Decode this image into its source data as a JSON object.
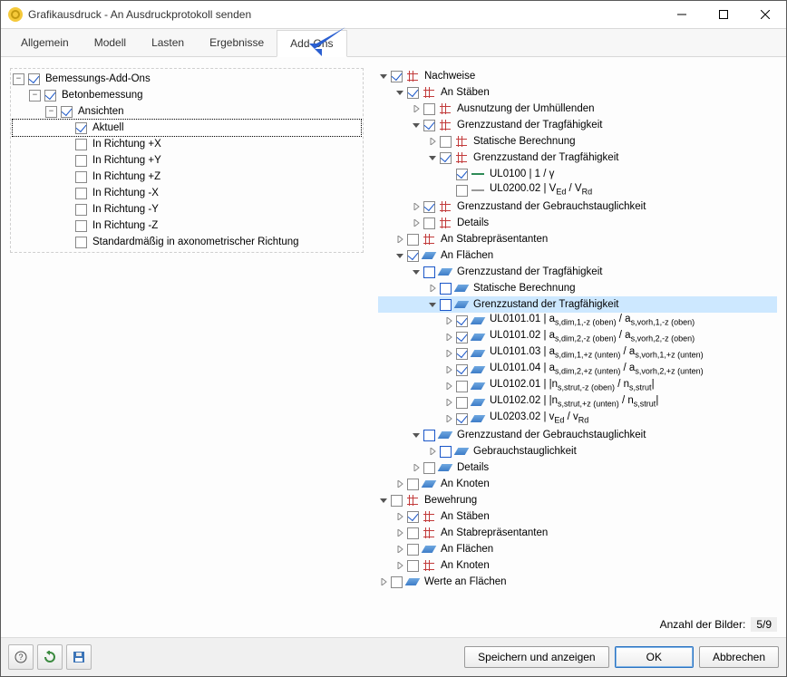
{
  "window": {
    "title": "Grafikausdruck - An Ausdruckprotokoll senden"
  },
  "tabs": [
    {
      "label": "Allgemein"
    },
    {
      "label": "Modell"
    },
    {
      "label": "Lasten"
    },
    {
      "label": "Ergebnisse"
    },
    {
      "label": "Add-Ons",
      "active": true
    }
  ],
  "left": [
    {
      "d": 0,
      "type": "box",
      "open": true,
      "chk": "on",
      "label": "Bemessungs-Add-Ons"
    },
    {
      "d": 1,
      "type": "box",
      "open": true,
      "chk": "on",
      "label": "Betonbemessung"
    },
    {
      "d": 2,
      "type": "box",
      "open": true,
      "chk": "on",
      "label": "Ansichten"
    },
    {
      "d": 3,
      "type": "leaf",
      "chk": "on",
      "label": "Aktuell",
      "sel": "focus"
    },
    {
      "d": 3,
      "type": "leaf",
      "chk": "off",
      "label": "In Richtung +X"
    },
    {
      "d": 3,
      "type": "leaf",
      "chk": "off",
      "label": "In Richtung +Y"
    },
    {
      "d": 3,
      "type": "leaf",
      "chk": "off",
      "label": "In Richtung +Z"
    },
    {
      "d": 3,
      "type": "leaf",
      "chk": "off",
      "label": "In Richtung -X"
    },
    {
      "d": 3,
      "type": "leaf",
      "chk": "off",
      "label": "In Richtung -Y"
    },
    {
      "d": 3,
      "type": "leaf",
      "chk": "off",
      "label": "In Richtung -Z"
    },
    {
      "d": 3,
      "type": "leaf",
      "chk": "off",
      "label": "Standardmäßig in axonometrischer Richtung"
    }
  ],
  "right": [
    {
      "d": 0,
      "chev": "down",
      "chk": "on",
      "icon": "chart",
      "label": "Nachweise"
    },
    {
      "d": 1,
      "chev": "down",
      "chk": "on",
      "icon": "chart",
      "label": "An Stäben"
    },
    {
      "d": 2,
      "chev": "right",
      "chk": "off",
      "icon": "chart",
      "label": "Ausnutzung der Umhüllenden"
    },
    {
      "d": 2,
      "chev": "down",
      "chk": "on",
      "icon": "chart",
      "label": "Grenzzustand der Tragfähigkeit"
    },
    {
      "d": 3,
      "chev": "right",
      "chk": "off",
      "icon": "chart",
      "label": "Statische Berechnung"
    },
    {
      "d": 3,
      "chev": "down",
      "chk": "on",
      "icon": "chart",
      "label": "Grenzzustand der Tragfähigkeit"
    },
    {
      "d": 4,
      "chev": "none",
      "chk": "on",
      "icon": "gline",
      "label": "UL0100 | 1 / γ"
    },
    {
      "d": 4,
      "chev": "none",
      "chk": "off",
      "icon": "gray",
      "html": "UL0200.02 | V<sub>Ed</sub> / V<sub>Rd</sub>"
    },
    {
      "d": 2,
      "chev": "right",
      "chk": "on",
      "icon": "chart",
      "label": "Grenzzustand der Gebrauchstauglichkeit"
    },
    {
      "d": 2,
      "chev": "right",
      "chk": "off",
      "icon": "chart",
      "label": "Details"
    },
    {
      "d": 1,
      "chev": "right",
      "chk": "off",
      "icon": "chart",
      "label": "An Stabrepräsentanten"
    },
    {
      "d": 1,
      "chev": "down",
      "chk": "on",
      "icon": "surf",
      "label": "An Flächen"
    },
    {
      "d": 2,
      "chev": "down",
      "chk": "outline",
      "icon": "surf",
      "label": "Grenzzustand der Tragfähigkeit"
    },
    {
      "d": 3,
      "chev": "right",
      "chk": "outline",
      "icon": "surf",
      "label": "Statische Berechnung"
    },
    {
      "d": 3,
      "chev": "down",
      "chk": "outline",
      "icon": "surf",
      "label": "Grenzzustand der Tragfähigkeit",
      "sel": "blue"
    },
    {
      "d": 4,
      "chev": "right",
      "chk": "on",
      "icon": "surf",
      "html": "UL0101.01 | a<sub>s,dim,1,-z (oben)</sub> / a<sub>s,vorh,1,-z (oben)</sub>"
    },
    {
      "d": 4,
      "chev": "right",
      "chk": "on",
      "icon": "surf",
      "html": "UL0101.02 | a<sub>s,dim,2,-z (oben)</sub> / a<sub>s,vorh,2,-z (oben)</sub>"
    },
    {
      "d": 4,
      "chev": "right",
      "chk": "on",
      "icon": "surf",
      "html": "UL0101.03 | a<sub>s,dim,1,+z (unten)</sub> / a<sub>s,vorh,1,+z (unten)</sub>"
    },
    {
      "d": 4,
      "chev": "right",
      "chk": "on",
      "icon": "surf",
      "html": "UL0101.04 | a<sub>s,dim,2,+z (unten)</sub> / a<sub>s,vorh,2,+z (unten)</sub>"
    },
    {
      "d": 4,
      "chev": "right",
      "chk": "off",
      "icon": "surf",
      "html": "UL0102.01 | |n<sub>s,strut,-z (oben)</sub> / n<sub>s,strut</sub>|"
    },
    {
      "d": 4,
      "chev": "right",
      "chk": "off",
      "icon": "surf",
      "html": "UL0102.02 | |n<sub>s,strut,+z (unten)</sub> / n<sub>s,strut</sub>|"
    },
    {
      "d": 4,
      "chev": "right",
      "chk": "on",
      "icon": "surf",
      "html": "UL0203.02 | v<sub>Ed</sub> / v<sub>Rd</sub>"
    },
    {
      "d": 2,
      "chev": "down",
      "chk": "outline",
      "icon": "surf",
      "label": "Grenzzustand der Gebrauchstauglichkeit"
    },
    {
      "d": 3,
      "chev": "right",
      "chk": "outline",
      "icon": "surf",
      "label": "Gebrauchstauglichkeit"
    },
    {
      "d": 2,
      "chev": "right",
      "chk": "off",
      "icon": "surf",
      "label": "Details"
    },
    {
      "d": 1,
      "chev": "right",
      "chk": "off",
      "icon": "surf",
      "label": "An Knoten"
    },
    {
      "d": 0,
      "chev": "down",
      "chk": "off",
      "icon": "chart",
      "label": "Bewehrung"
    },
    {
      "d": 1,
      "chev": "right",
      "chk": "on",
      "icon": "chart",
      "label": "An Stäben"
    },
    {
      "d": 1,
      "chev": "right",
      "chk": "off",
      "icon": "chart",
      "label": "An Stabrepräsentanten"
    },
    {
      "d": 1,
      "chev": "right",
      "chk": "off",
      "icon": "surf",
      "label": "An Flächen"
    },
    {
      "d": 1,
      "chev": "right",
      "chk": "off",
      "icon": "chart",
      "label": "An Knoten"
    },
    {
      "d": 0,
      "chev": "right",
      "chk": "off",
      "icon": "surf",
      "label": "Werte an Flächen"
    }
  ],
  "footer": {
    "counter_label": "Anzahl der Bilder:",
    "counter_value": "5/9"
  },
  "buttons": {
    "save_show": "Speichern und anzeigen",
    "ok": "OK",
    "cancel": "Abbrechen"
  }
}
